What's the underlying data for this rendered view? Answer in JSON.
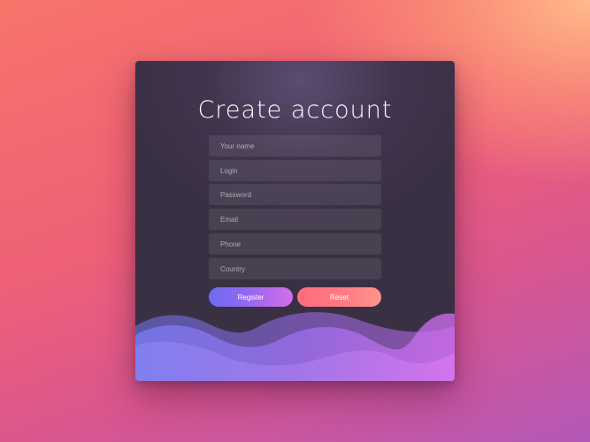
{
  "form": {
    "title": "Create account",
    "fields": [
      {
        "name": "your-name-field",
        "placeholder": "Your name"
      },
      {
        "name": "login-field",
        "placeholder": "Login"
      },
      {
        "name": "password-field",
        "placeholder": "Password"
      },
      {
        "name": "email-field",
        "placeholder": "Email"
      },
      {
        "name": "phone-field",
        "placeholder": "Phone"
      },
      {
        "name": "country-field",
        "placeholder": "Country"
      }
    ],
    "buttons": {
      "register_label": "Register",
      "reset_label": "Reset"
    }
  },
  "colors": {
    "card_background": "#3a3044",
    "register_gradient": [
      "#6a6cf2",
      "#d46fe8"
    ],
    "reset_gradient": [
      "#ff6b7d",
      "#ff9589"
    ],
    "wave_colors": [
      "#6f78f5",
      "#a468ec",
      "#d36cf0"
    ]
  }
}
